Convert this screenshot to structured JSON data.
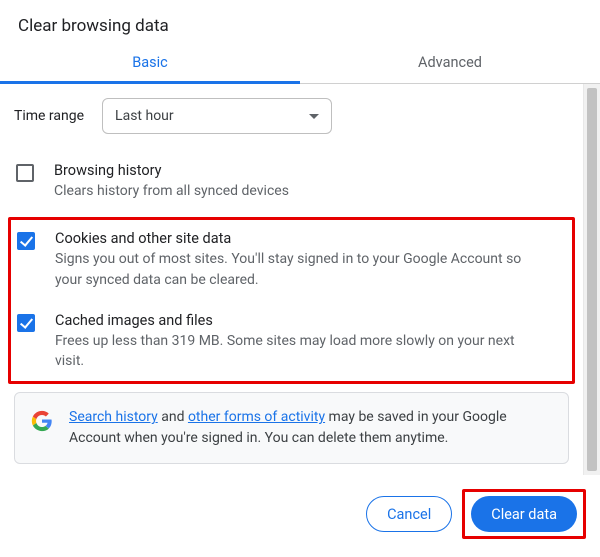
{
  "title": "Clear browsing data",
  "tabs": {
    "basic": "Basic",
    "advanced": "Advanced"
  },
  "time": {
    "label": "Time range",
    "value": "Last hour"
  },
  "opts": {
    "history": {
      "title": "Browsing history",
      "desc": "Clears history from all synced devices"
    },
    "cookies": {
      "title": "Cookies and other site data",
      "desc": "Signs you out of most sites. You'll stay signed in to your Google Account so your synced data can be cleared."
    },
    "cache": {
      "title": "Cached images and files",
      "desc": "Frees up less than 319 MB. Some sites may load more slowly on your next visit."
    }
  },
  "info": {
    "link1": "Search history",
    "mid1": " and ",
    "link2": "other forms of activity",
    "rest": " may be saved in your Google Account when you're signed in. You can delete them anytime."
  },
  "buttons": {
    "cancel": "Cancel",
    "clear": "Clear data"
  }
}
